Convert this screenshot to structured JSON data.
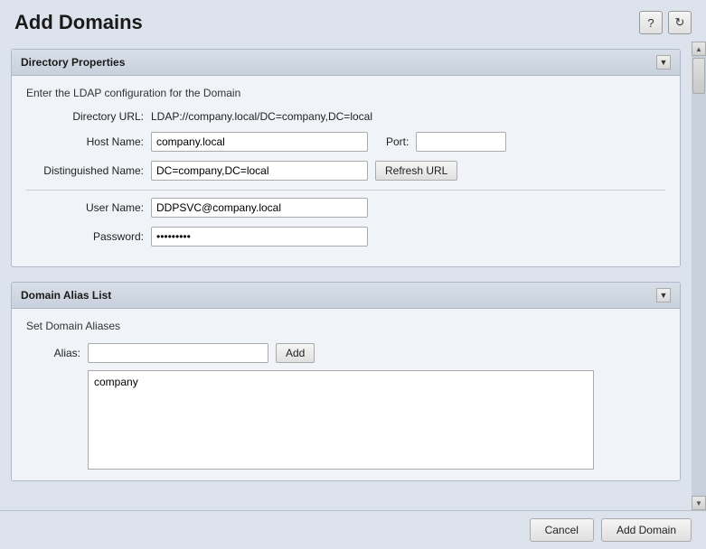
{
  "header": {
    "title": "Add Domains",
    "help_icon": "?",
    "refresh_icon": "↻"
  },
  "directory_properties": {
    "section_title": "Directory Properties",
    "description": "Enter the LDAP configuration for the Domain",
    "collapse_symbol": "▼",
    "fields": {
      "directory_url_label": "Directory URL:",
      "directory_url_value": "LDAP://company.local/DC=company,DC=local",
      "host_name_label": "Host Name:",
      "host_name_value": "company.local",
      "port_label": "Port:",
      "port_value": "",
      "distinguished_name_label": "Distinguished Name:",
      "distinguished_name_value": "DC=company,DC=local",
      "refresh_url_label": "Refresh URL",
      "user_name_label": "User Name:",
      "user_name_value": "DDPSVC@company.local",
      "password_label": "Password:",
      "password_value": "••••••••"
    }
  },
  "domain_alias_list": {
    "section_title": "Domain Alias List",
    "description": "Set Domain Aliases",
    "collapse_symbol": "▼",
    "alias_label": "Alias:",
    "alias_placeholder": "",
    "add_button_label": "Add",
    "aliases": [
      "company"
    ]
  },
  "footer": {
    "cancel_label": "Cancel",
    "add_domain_label": "Add Domain"
  }
}
